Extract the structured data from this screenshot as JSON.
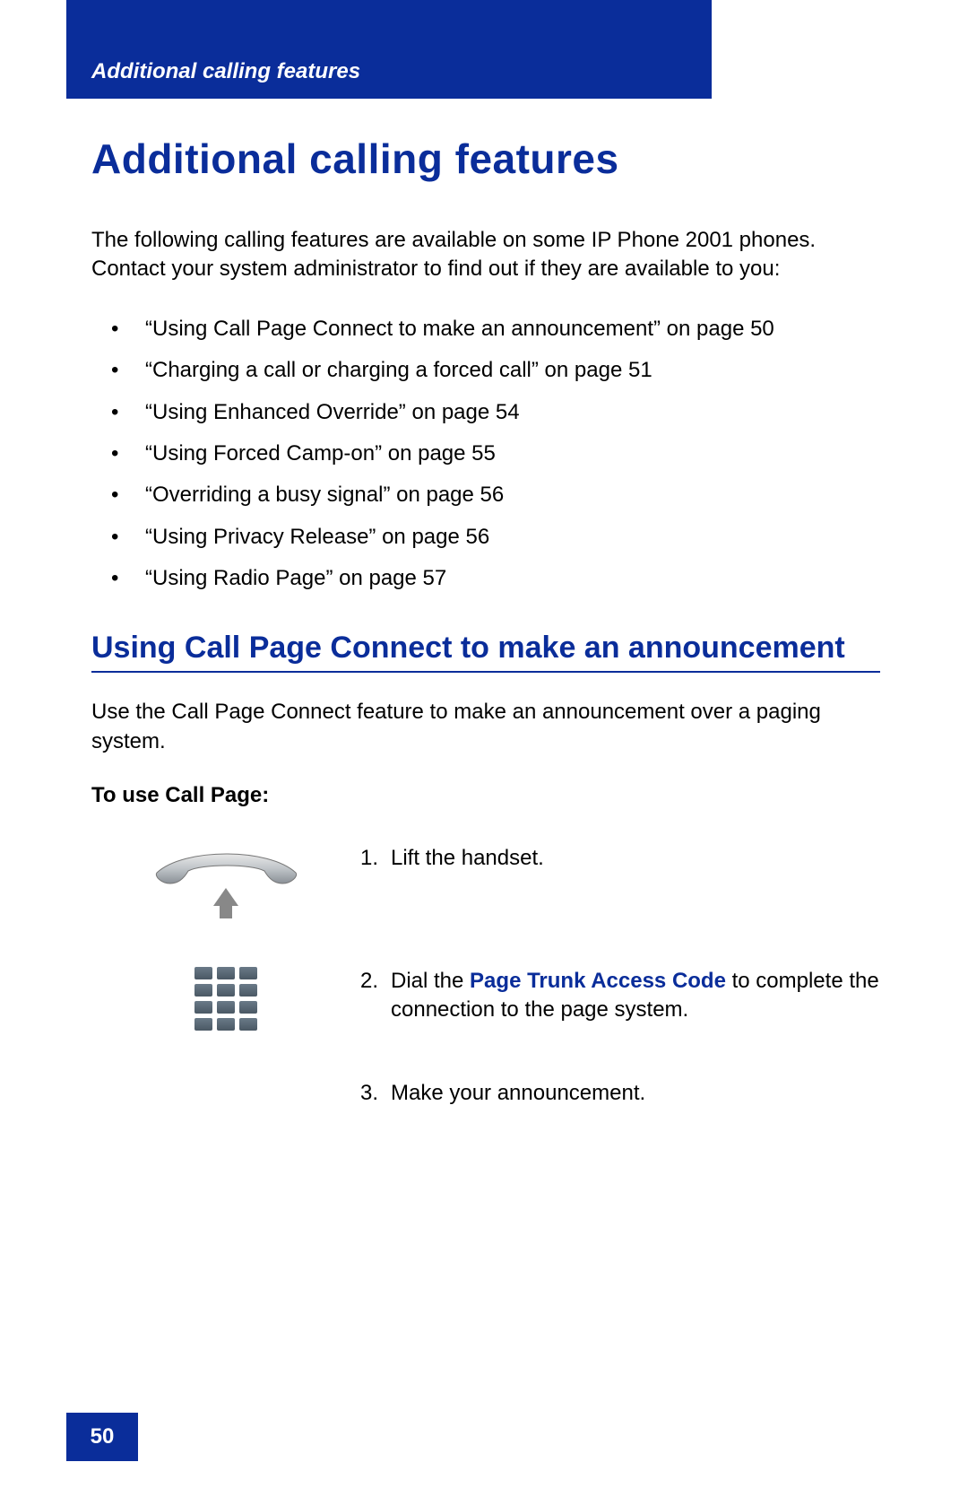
{
  "header": {
    "title": "Additional calling features"
  },
  "main": {
    "title": "Additional calling features",
    "intro": "The following calling features are available on some IP Phone 2001 phones. Contact your system administrator to find out if they are available to you:",
    "features": [
      "“Using Call Page Connect to make an announcement” on page 50",
      "“Charging a call or charging a forced call” on page 51",
      "“Using Enhanced Override” on page 54",
      "“Using Forced Camp-on” on page 55",
      "“Overriding a busy signal” on page 56",
      "“Using Privacy Release” on page 56",
      "“Using Radio Page” on page 57"
    ]
  },
  "section": {
    "title": "Using Call Page Connect to make an announcement",
    "intro": "Use the Call Page Connect feature to make an announcement over a paging system.",
    "instructions_label": "To use Call Page:",
    "steps": {
      "s1": {
        "num": "1.",
        "text": "Lift the handset."
      },
      "s2": {
        "num": "2.",
        "pre": "Dial the ",
        "bold": "Page Trunk Access Code",
        "post": " to complete the connection to the page system."
      },
      "s3": {
        "num": "3.",
        "text": "Make your announcement."
      }
    }
  },
  "footer": {
    "page": "50"
  }
}
